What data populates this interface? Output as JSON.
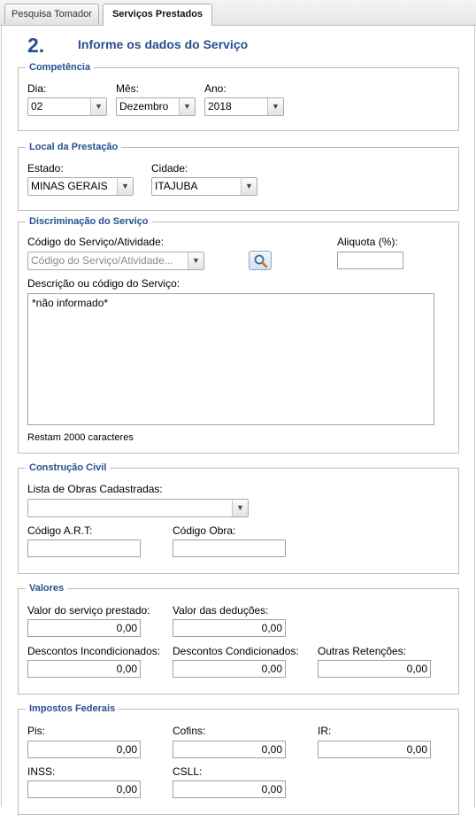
{
  "tabs": [
    {
      "label": "Pesquisa Tomador",
      "active": false
    },
    {
      "label": "Serviços Prestados",
      "active": true
    }
  ],
  "header": {
    "step": "2.",
    "title": "Informe os dados do Serviço"
  },
  "competencia": {
    "legend": "Competência",
    "dia_label": "Dia:",
    "dia_value": "02",
    "mes_label": "Mês:",
    "mes_value": "Dezembro",
    "ano_label": "Ano:",
    "ano_value": "2018"
  },
  "local": {
    "legend": "Local da Prestação",
    "estado_label": "Estado:",
    "estado_value": "MINAS GERAIS",
    "cidade_label": "Cidade:",
    "cidade_value": "ITAJUBA"
  },
  "discriminacao": {
    "legend": "Discriminação do Serviço",
    "codigo_label": "Código do Serviço/Atividade:",
    "codigo_placeholder": "Código do Serviço/Atividade...",
    "aliquota_label": "Aliquota (%):",
    "aliquota_value": "",
    "descricao_label": "Descrição ou código do Serviço:",
    "descricao_value": "*não informado*",
    "restam": "Restam 2000 caracteres",
    "lookup_icon": "search-icon"
  },
  "construcao": {
    "legend": "Construção Civil",
    "obras_label": "Lista de Obras Cadastradas:",
    "obras_value": "",
    "art_label": "Código A.R.T:",
    "art_value": "",
    "obra_label": "Código Obra:",
    "obra_value": ""
  },
  "valores": {
    "legend": "Valores",
    "servico_label": "Valor do serviço prestado:",
    "servico_value": "0,00",
    "deducoes_label": "Valor das deduções:",
    "deducoes_value": "0,00",
    "desc_incond_label": "Descontos Incondicionados:",
    "desc_incond_value": "0,00",
    "desc_cond_label": "Descontos Condicionados:",
    "desc_cond_value": "0,00",
    "outras_label": "Outras Retenções:",
    "outras_value": "0,00"
  },
  "impostos": {
    "legend": "Impostos Federais",
    "pis_label": "Pis:",
    "pis_value": "0,00",
    "cofins_label": "Cofins:",
    "cofins_value": "0,00",
    "ir_label": "IR:",
    "ir_value": "0,00",
    "inss_label": "INSS:",
    "inss_value": "0,00",
    "csll_label": "CSLL:",
    "csll_value": "0,00"
  },
  "colors": {
    "accent": "#27508f",
    "border": "#bcbcbc"
  }
}
